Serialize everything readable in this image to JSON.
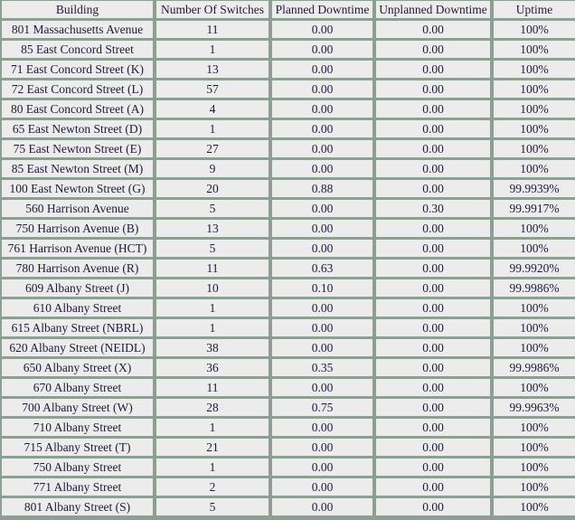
{
  "colors": {
    "border": "#8e9e93",
    "cell": "#ececec",
    "good": "#8fd14f",
    "bad": "#efb8b0",
    "warn": "#f3ebe3",
    "text": "#1c1c38"
  },
  "table": {
    "headers": [
      "Building",
      "Number Of Switches",
      "Planned Downtime",
      "Unplanned Downtime",
      "Uptime"
    ],
    "rows": [
      {
        "building": "801 Massachusetts Avenue",
        "switches": "11",
        "planned": "0.00",
        "unplanned": "0.00",
        "uptime": "100%",
        "planned_status": "",
        "unplanned_status": "",
        "uptime_status": ""
      },
      {
        "building": "85 East Concord Street",
        "switches": "1",
        "planned": "0.00",
        "unplanned": "0.00",
        "uptime": "100%",
        "planned_status": "",
        "unplanned_status": "",
        "uptime_status": ""
      },
      {
        "building": "71 East Concord Street (K)",
        "switches": "13",
        "planned": "0.00",
        "unplanned": "0.00",
        "uptime": "100%",
        "planned_status": "",
        "unplanned_status": "",
        "uptime_status": ""
      },
      {
        "building": "72 East Concord Street (L)",
        "switches": "57",
        "planned": "0.00",
        "unplanned": "0.00",
        "uptime": "100%",
        "planned_status": "",
        "unplanned_status": "",
        "uptime_status": ""
      },
      {
        "building": "80 East Concord Street (A)",
        "switches": "4",
        "planned": "0.00",
        "unplanned": "0.00",
        "uptime": "100%",
        "planned_status": "",
        "unplanned_status": "",
        "uptime_status": ""
      },
      {
        "building": "65 East Newton Street (D)",
        "switches": "1",
        "planned": "0.00",
        "unplanned": "0.00",
        "uptime": "100%",
        "planned_status": "",
        "unplanned_status": "",
        "uptime_status": ""
      },
      {
        "building": "75 East Newton Street (E)",
        "switches": "27",
        "planned": "0.00",
        "unplanned": "0.00",
        "uptime": "100%",
        "planned_status": "",
        "unplanned_status": "",
        "uptime_status": ""
      },
      {
        "building": "85 East Newton Street (M)",
        "switches": "9",
        "planned": "0.00",
        "unplanned": "0.00",
        "uptime": "100%",
        "planned_status": "",
        "unplanned_status": "",
        "uptime_status": ""
      },
      {
        "building": "100 East Newton Street (G)",
        "switches": "20",
        "planned": "0.88",
        "unplanned": "0.00",
        "uptime": "99.9939%",
        "planned_status": "good",
        "unplanned_status": "",
        "uptime_status": "good"
      },
      {
        "building": "560 Harrison Avenue",
        "switches": "5",
        "planned": "0.00",
        "unplanned": "0.30",
        "uptime": "99.9917%",
        "planned_status": "",
        "unplanned_status": "bad",
        "uptime_status": "bad"
      },
      {
        "building": "750 Harrison Avenue (B)",
        "switches": "13",
        "planned": "0.00",
        "unplanned": "0.00",
        "uptime": "100%",
        "planned_status": "",
        "unplanned_status": "",
        "uptime_status": ""
      },
      {
        "building": "761 Harrison Avenue (HCT)",
        "switches": "5",
        "planned": "0.00",
        "unplanned": "0.00",
        "uptime": "100%",
        "planned_status": "",
        "unplanned_status": "",
        "uptime_status": ""
      },
      {
        "building": "780 Harrison Avenue (R)",
        "switches": "11",
        "planned": "0.63",
        "unplanned": "0.00",
        "uptime": "99.9920%",
        "planned_status": "good",
        "unplanned_status": "",
        "uptime_status": "good"
      },
      {
        "building": "609 Albany Street (J)",
        "switches": "10",
        "planned": "0.10",
        "unplanned": "0.00",
        "uptime": "99.9986%",
        "planned_status": "good",
        "unplanned_status": "",
        "uptime_status": "good"
      },
      {
        "building": "610 Albany Street",
        "switches": "1",
        "planned": "0.00",
        "unplanned": "0.00",
        "uptime": "100%",
        "planned_status": "",
        "unplanned_status": "",
        "uptime_status": ""
      },
      {
        "building": "615 Albany Street (NBRL)",
        "switches": "1",
        "planned": "0.00",
        "unplanned": "0.00",
        "uptime": "100%",
        "planned_status": "",
        "unplanned_status": "",
        "uptime_status": ""
      },
      {
        "building": "620 Albany Street (NEIDL)",
        "switches": "38",
        "planned": "0.00",
        "unplanned": "0.00",
        "uptime": "100%",
        "planned_status": "",
        "unplanned_status": "warn",
        "uptime_status": "warn"
      },
      {
        "building": "650 Albany Street (X)",
        "switches": "36",
        "planned": "0.35",
        "unplanned": "0.00",
        "uptime": "99.9986%",
        "planned_status": "good",
        "unplanned_status": "",
        "uptime_status": "good"
      },
      {
        "building": "670 Albany Street",
        "switches": "11",
        "planned": "0.00",
        "unplanned": "0.00",
        "uptime": "100%",
        "planned_status": "",
        "unplanned_status": "",
        "uptime_status": ""
      },
      {
        "building": "700 Albany Street (W)",
        "switches": "28",
        "planned": "0.75",
        "unplanned": "0.00",
        "uptime": "99.9963%",
        "planned_status": "good",
        "unplanned_status": "",
        "uptime_status": "good"
      },
      {
        "building": "710 Albany Street",
        "switches": "1",
        "planned": "0.00",
        "unplanned": "0.00",
        "uptime": "100%",
        "planned_status": "",
        "unplanned_status": "",
        "uptime_status": ""
      },
      {
        "building": "715 Albany Street (T)",
        "switches": "21",
        "planned": "0.00",
        "unplanned": "0.00",
        "uptime": "100%",
        "planned_status": "",
        "unplanned_status": "",
        "uptime_status": ""
      },
      {
        "building": "750 Albany Street",
        "switches": "1",
        "planned": "0.00",
        "unplanned": "0.00",
        "uptime": "100%",
        "planned_status": "",
        "unplanned_status": "",
        "uptime_status": ""
      },
      {
        "building": "771 Albany Street",
        "switches": "2",
        "planned": "0.00",
        "unplanned": "0.00",
        "uptime": "100%",
        "planned_status": "",
        "unplanned_status": "",
        "uptime_status": ""
      },
      {
        "building": "801 Albany Street (S)",
        "switches": "5",
        "planned": "0.00",
        "unplanned": "0.00",
        "uptime": "100%",
        "planned_status": "",
        "unplanned_status": "",
        "uptime_status": ""
      }
    ]
  }
}
